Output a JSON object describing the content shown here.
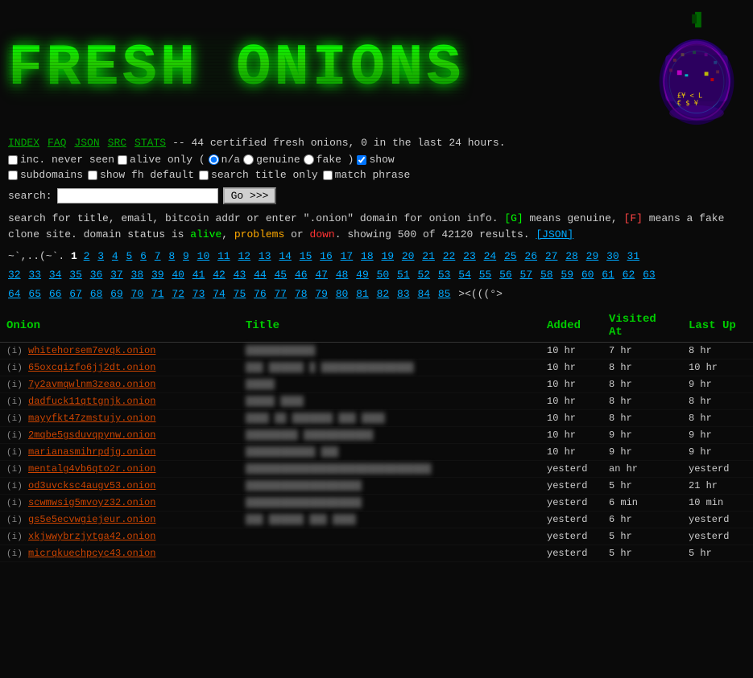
{
  "header": {
    "title": "FRESH ONIONS",
    "logo_alt": "Onion Logo"
  },
  "navbar": {
    "links": [
      "INDEX",
      "FAQ",
      "JSON",
      "SRC",
      "STATS"
    ],
    "description": "-- 44 certified fresh onions, 0 in the last 24 hours."
  },
  "options": {
    "inc_never_seen_label": "inc. never seen",
    "alive_only_label": "alive only (",
    "na_label": "n/a",
    "genuine_label": "genuine",
    "fake_label": "fake )",
    "show_label": "show",
    "subdomains_label": "subdomains",
    "show_fh_default_label": "show fh default",
    "search_title_only_label": "search title only",
    "match_phrase_label": "match phrase"
  },
  "search": {
    "label": "search:",
    "placeholder": "",
    "button_label": "Go >>>"
  },
  "info": {
    "line1": "search for title, email, bitcoin addr or enter \".onion\" domain for onion info.",
    "genuine_badge": "[G]",
    "genuine_note": "means genuine,",
    "fake_badge": "[F]",
    "fake_note": "means a fake",
    "line2": "clone site. domain status is",
    "alive": "alive",
    "comma": ",",
    "problems": "problems",
    "or": "or",
    "down": "down",
    "showing": ". showing 500 of 42120 results.",
    "json_link": "[JSON]"
  },
  "pagination": {
    "prefix": "~`,.(~`.",
    "current": "1",
    "pages": [
      "2",
      "3",
      "4",
      "5",
      "6",
      "7",
      "8",
      "9",
      "10",
      "11",
      "12",
      "13",
      "14",
      "15",
      "16",
      "17",
      "18",
      "19",
      "20",
      "21",
      "22",
      "23",
      "24",
      "25",
      "26",
      "27",
      "28",
      "29",
      "30",
      "31",
      "32",
      "33",
      "34",
      "35",
      "36",
      "37",
      "38",
      "39",
      "40",
      "41",
      "42",
      "43",
      "44",
      "45",
      "46",
      "47",
      "48",
      "49",
      "50",
      "51",
      "52",
      "53",
      "54",
      "55",
      "56",
      "57",
      "58",
      "59",
      "60",
      "61",
      "62",
      "63",
      "64",
      "65",
      "66",
      "67",
      "68",
      "69",
      "70",
      "71",
      "72",
      "73",
      "74",
      "75",
      "76",
      "77",
      "78",
      "79",
      "80",
      "81",
      "82",
      "83",
      "84",
      "85"
    ],
    "suffix": "><(((°>"
  },
  "table": {
    "headers": {
      "onion": "Onion",
      "title": "Title",
      "added": "Added",
      "visited": "Visited At",
      "lastup": "Last Up"
    },
    "rows": [
      {
        "info": "(i)",
        "onion": "whitehorsem7evqk.onion",
        "title": "████████████",
        "added": "10 hr",
        "visited": "7 hr",
        "lastup": "8 hr"
      },
      {
        "info": "(i)",
        "onion": "65oxcqizfo6jj2dt.onion",
        "title": "███ ██████ █ ████████████████",
        "added": "10 hr",
        "visited": "8 hr",
        "lastup": "10 hr"
      },
      {
        "info": "(i)",
        "onion": "7y2avmqwlnm3zeao.onion",
        "title": "█████",
        "added": "10 hr",
        "visited": "8 hr",
        "lastup": "9 hr"
      },
      {
        "info": "(i)",
        "onion": "dadfuck11qttgnjk.onion",
        "title": "█████ ████",
        "added": "10 hr",
        "visited": "8 hr",
        "lastup": "8 hr"
      },
      {
        "info": "(i)",
        "onion": "mayyfkt47zmstujy.onion",
        "title": "████ ██ ███████ ███ ████",
        "added": "10 hr",
        "visited": "8 hr",
        "lastup": "8 hr"
      },
      {
        "info": "(i)",
        "onion": "2mqbe5gsduvqpynw.onion",
        "title": "█████████ ████████████",
        "added": "10 hr",
        "visited": "9 hr",
        "lastup": "9 hr"
      },
      {
        "info": "(i)",
        "onion": "marianasmihrpdjg.onion",
        "title": "████████████ ███",
        "added": "10 hr",
        "visited": "9 hr",
        "lastup": "9 hr"
      },
      {
        "info": "(i)",
        "onion": "mentalg4vb6qto2r.onion",
        "title": "████████████████████████████████",
        "added": "yesterd",
        "visited": "an hr",
        "lastup": "yesterd"
      },
      {
        "info": "(i)",
        "onion": "od3uvcksc4augv53.onion",
        "title": "████████████████████",
        "added": "yesterd",
        "visited": "5 hr",
        "lastup": "21 hr"
      },
      {
        "info": "(i)",
        "onion": "scwmwsig5mvoyz32.onion",
        "title": "████████████████████",
        "added": "yesterd",
        "visited": "6 min",
        "lastup": "10 min"
      },
      {
        "info": "(i)",
        "onion": "gs5e5ecvwgiejeur.onion",
        "title": "███ ██████ ███ ████",
        "added": "yesterd",
        "visited": "6 hr",
        "lastup": "yesterd"
      },
      {
        "info": "(i)",
        "onion": "xkjwwybrzjytga42.onion",
        "title": "",
        "added": "yesterd",
        "visited": "5 hr",
        "lastup": "yesterd"
      },
      {
        "info": "(i)",
        "onion": "micrqkuechpcyc43.onion",
        "title": "",
        "added": "yesterd",
        "visited": "5 hr",
        "lastup": "5 hr"
      }
    ]
  }
}
